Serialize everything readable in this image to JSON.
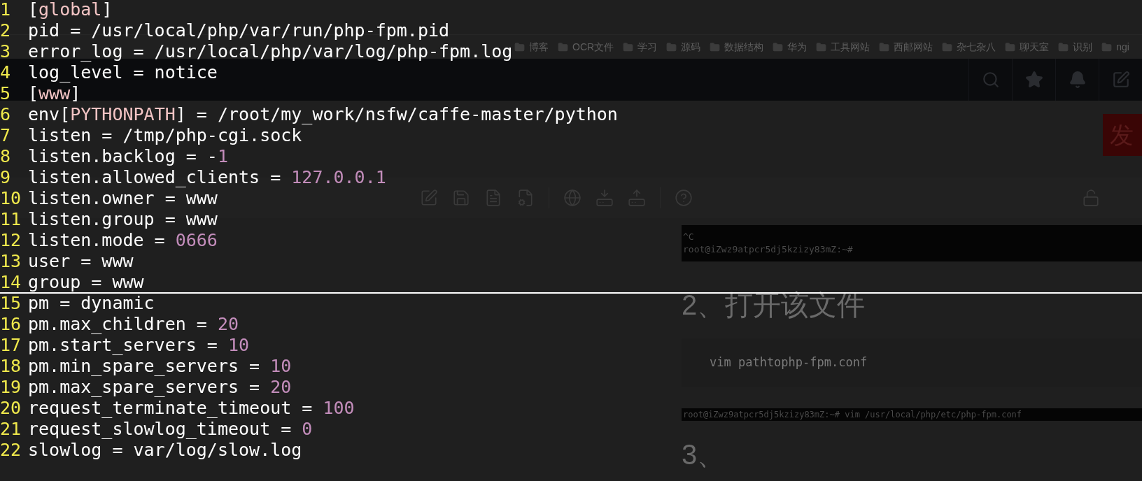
{
  "editor": {
    "lines": [
      {
        "number": "1",
        "cursor": false,
        "segments": [
          {
            "kind": "text",
            "text": "["
          },
          {
            "kind": "section",
            "text": "global"
          },
          {
            "kind": "text",
            "text": "]"
          }
        ]
      },
      {
        "number": "2",
        "cursor": false,
        "segments": [
          {
            "kind": "text",
            "text": "pid = /usr/local/php/var/run/php-fpm.pid"
          }
        ]
      },
      {
        "number": "3",
        "cursor": false,
        "segments": [
          {
            "kind": "text",
            "text": "error_log = /usr/local/php/var/log/php-fpm.log"
          }
        ]
      },
      {
        "number": "4",
        "cursor": false,
        "segments": [
          {
            "kind": "text",
            "text": "log_level = notice"
          }
        ]
      },
      {
        "number": "5",
        "cursor": false,
        "segments": [
          {
            "kind": "text",
            "text": "["
          },
          {
            "kind": "section",
            "text": "www"
          },
          {
            "kind": "text",
            "text": "]"
          }
        ]
      },
      {
        "number": "6",
        "cursor": false,
        "segments": [
          {
            "kind": "text",
            "text": "env["
          },
          {
            "kind": "section",
            "text": "PYTHONPATH"
          },
          {
            "kind": "text",
            "text": "] = /root/my_work/nsfw/caffe-master/python"
          }
        ]
      },
      {
        "number": "7",
        "cursor": false,
        "segments": [
          {
            "kind": "text",
            "text": "listen = /tmp/php-cgi.sock"
          }
        ]
      },
      {
        "number": "8",
        "cursor": false,
        "segments": [
          {
            "kind": "text",
            "text": "listen.backlog = -"
          },
          {
            "kind": "number",
            "text": "1"
          }
        ]
      },
      {
        "number": "9",
        "cursor": false,
        "segments": [
          {
            "kind": "text",
            "text": "listen.allowed_clients = "
          },
          {
            "kind": "number",
            "text": "127.0.0.1"
          }
        ]
      },
      {
        "number": "10",
        "cursor": false,
        "segments": [
          {
            "kind": "text",
            "text": "listen.owner = www"
          }
        ]
      },
      {
        "number": "11",
        "cursor": false,
        "segments": [
          {
            "kind": "text",
            "text": "listen.group = www"
          }
        ]
      },
      {
        "number": "12",
        "cursor": false,
        "segments": [
          {
            "kind": "text",
            "text": "listen.mode = "
          },
          {
            "kind": "number",
            "text": "0666"
          }
        ]
      },
      {
        "number": "13",
        "cursor": false,
        "segments": [
          {
            "kind": "text",
            "text": "user = www"
          }
        ]
      },
      {
        "number": "14",
        "cursor": true,
        "segments": [
          {
            "kind": "text",
            "text": "group = www"
          }
        ]
      },
      {
        "number": "15",
        "cursor": false,
        "segments": [
          {
            "kind": "text",
            "text": "pm = dynamic"
          }
        ]
      },
      {
        "number": "16",
        "cursor": false,
        "segments": [
          {
            "kind": "text",
            "text": "pm.max_children = "
          },
          {
            "kind": "number",
            "text": "20"
          }
        ]
      },
      {
        "number": "17",
        "cursor": false,
        "segments": [
          {
            "kind": "text",
            "text": "pm.start_servers = "
          },
          {
            "kind": "number",
            "text": "10"
          }
        ]
      },
      {
        "number": "18",
        "cursor": false,
        "segments": [
          {
            "kind": "text",
            "text": "pm.min_spare_servers = "
          },
          {
            "kind": "number",
            "text": "10"
          }
        ]
      },
      {
        "number": "19",
        "cursor": false,
        "segments": [
          {
            "kind": "text",
            "text": "pm.max_spare_servers = "
          },
          {
            "kind": "number",
            "text": "20"
          }
        ]
      },
      {
        "number": "20",
        "cursor": false,
        "segments": [
          {
            "kind": "text",
            "text": "request_terminate_timeout = "
          },
          {
            "kind": "number",
            "text": "100"
          }
        ]
      },
      {
        "number": "21",
        "cursor": false,
        "segments": [
          {
            "kind": "text",
            "text": "request_slowlog_timeout = "
          },
          {
            "kind": "number",
            "text": "0"
          }
        ]
      },
      {
        "number": "22",
        "cursor": false,
        "segments": [
          {
            "kind": "text",
            "text": "slowlog = var/log/slow.log"
          }
        ]
      }
    ]
  },
  "browser": {
    "bookmarks": [
      "博客",
      "OCR文件",
      "学习",
      "源码",
      "数据结构",
      "华为",
      "工具网站",
      "西邮网站",
      "杂七杂八",
      "聊天室",
      "识别",
      "ngi"
    ],
    "publish_button": "发",
    "terminal_1": [
      "^C",
      "root@iZwz9atpcr5dj5kzizy83mZ:~#"
    ],
    "heading": "2、打开该文件",
    "code": "vim pathtophp-fpm.conf",
    "terminal_2": "root@iZwz9atpcr5dj5kzizy83mZ:~# vim /usr/local/php/etc/php-fpm.conf",
    "next_heading": "3、"
  }
}
